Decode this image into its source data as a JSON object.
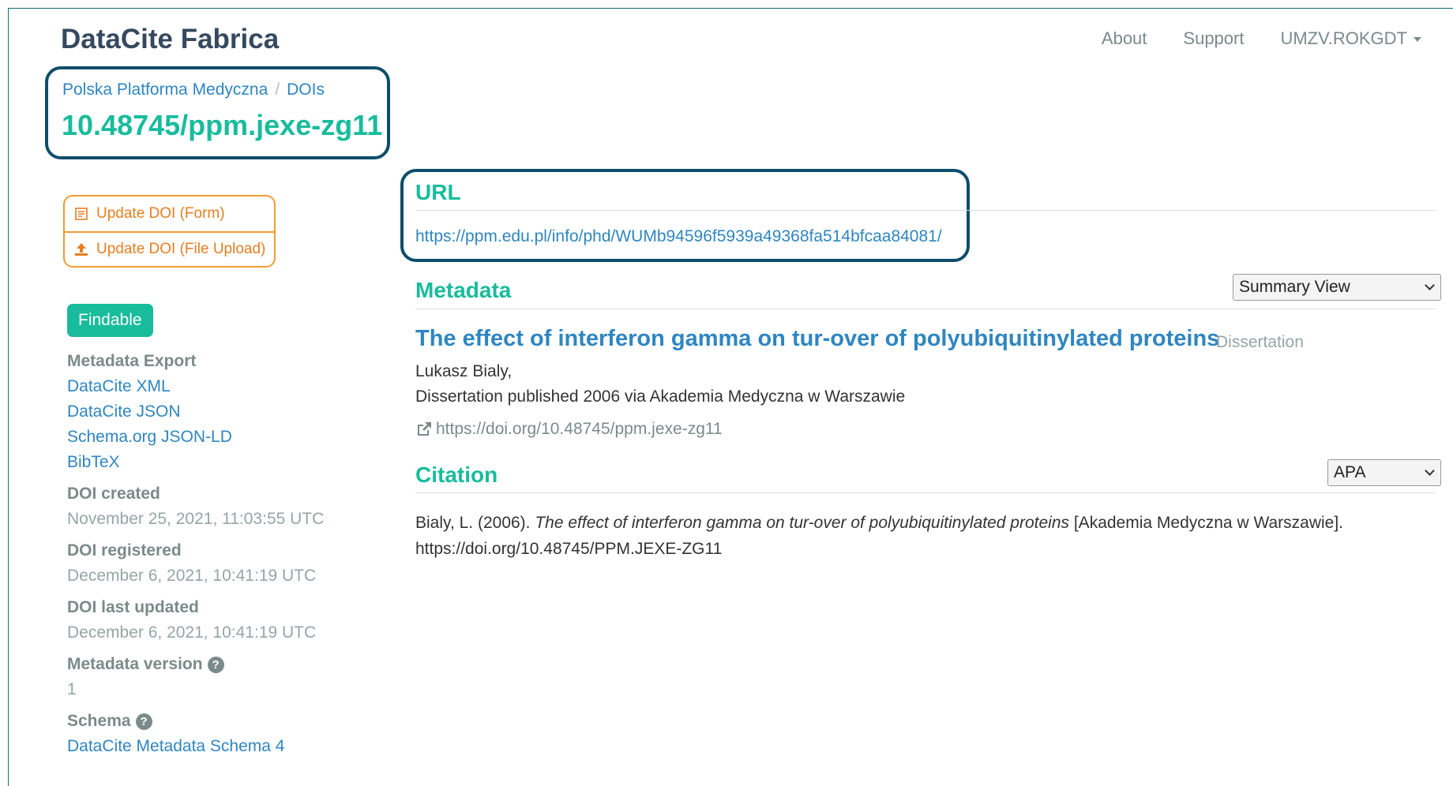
{
  "header": {
    "brand": "DataCite Fabrica",
    "nav": {
      "about": "About",
      "support": "Support",
      "user": "UMZV.ROKGDT"
    }
  },
  "breadcrumb": {
    "provider": "Polska Platforma Medyczna",
    "section": "DOIs"
  },
  "doi": "10.48745/ppm.jexe-zg11",
  "actions": {
    "update_form": "Update DOI (Form)",
    "update_file": "Update DOI (File Upload)"
  },
  "status_badge": "Findable",
  "sidebar": {
    "metadata_export_label": "Metadata Export",
    "exports": [
      "DataCite XML",
      "DataCite JSON",
      "Schema.org JSON-LD",
      "BibTeX"
    ],
    "created_label": "DOI created",
    "created_value": "November 25, 2021, 11:03:55 UTC",
    "registered_label": "DOI registered",
    "registered_value": "December 6, 2021, 10:41:19 UTC",
    "updated_label": "DOI last updated",
    "updated_value": "December 6, 2021, 10:41:19 UTC",
    "version_label": "Metadata version",
    "version_value": "1",
    "schema_label": "Schema",
    "schema_value": "DataCite Metadata Schema 4"
  },
  "url_section": {
    "heading": "URL",
    "url": "https://ppm.edu.pl/info/phd/WUMb94596f5939a49368fa514bfcaa84081/"
  },
  "metadata_section": {
    "heading": "Metadata",
    "view_select": "Summary View",
    "title": "The effect of interferon gamma on tur-over of polyubiquitinylated proteins",
    "resource_type": "Dissertation",
    "creator": "Lukasz Bialy,",
    "publication": "Dissertation published 2006 via Akademia Medyczna w Warszawie",
    "doi_url": "https://doi.org/10.48745/ppm.jexe-zg11"
  },
  "citation_section": {
    "heading": "Citation",
    "style_select": "APA",
    "prefix": "Bialy, L. (2006). ",
    "title_italic": "The effect of interferon gamma on tur-over of polyubiquitinylated proteins",
    "suffix": " [Akademia Medyczna w Warszawie].",
    "doi": "https://doi.org/10.48745/PPM.JEXE-ZG11"
  },
  "colors": {
    "accent": "#18bc9c",
    "link": "#2e86c1",
    "warning": "#f39c34",
    "highlight": "#0d4e6b"
  },
  "icons": [
    "form-icon",
    "upload-icon",
    "question-icon",
    "external-link-icon",
    "caret-down-icon",
    "chevron-down-icon"
  ]
}
